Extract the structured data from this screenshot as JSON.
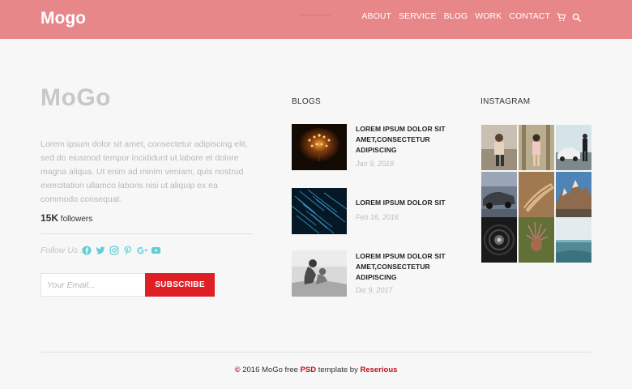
{
  "header": {
    "logo": "Mogo",
    "nav": [
      "ABOUT",
      "SERVICE",
      "BLOG",
      "WORK",
      "CONTACT"
    ],
    "icons": [
      "cart-icon",
      "search-icon"
    ]
  },
  "about": {
    "title": "MoGo",
    "description": "Lorem ipsum dolor sit amet, consectetur adipiscing elit, sed do eiusmod tempor incididunt ut labore et dolore magna aliqua. Ut enim ad minim veniam, quis nostrud exercitation ullamco laboris nisi ut aliquip ex ea commodo consequat.",
    "followers_count": "15K",
    "followers_label": "followers",
    "follow_label": "Follow Us :",
    "socials": [
      "facebook-icon",
      "twitter-icon",
      "instagram-icon",
      "pinterest-icon",
      "google-plus-icon",
      "youtube-icon"
    ],
    "social_color": "#5fcfd3"
  },
  "subscribe": {
    "placeholder": "Your Email...",
    "button": "SUBSCRIBE",
    "button_color": "#df1f26"
  },
  "blogs": {
    "title": "BLOGS",
    "items": [
      {
        "title": "LOREM IPSUM DOLOR SIT AMET,CONSECTETUR ADIPISCING",
        "date": "Jan 9, 2018"
      },
      {
        "title": "LOREM IPSUM DOLOR SIT",
        "date": "Feb 16, 2016"
      },
      {
        "title": "LOREM IPSUM DOLOR SIT AMET,CONSECTETUR ADIPISCING",
        "date": "Dic 9, 2017"
      }
    ]
  },
  "instagram": {
    "title": "INSTAGRAM"
  },
  "footer": {
    "copyright_symbol": "©",
    "text1": " 2016 MoGo free ",
    "psd": "PSD",
    "text2": " template by ",
    "author": "Reserious"
  },
  "colors": {
    "header_bg": "#e8878a",
    "accent_red": "#df1f26"
  }
}
